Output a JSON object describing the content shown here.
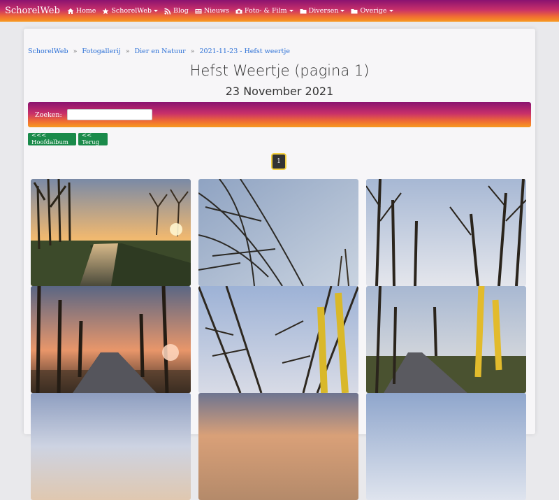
{
  "navbar": {
    "brand": "SchorelWeb",
    "items": [
      {
        "label": "Home",
        "icon": "home-icon",
        "dropdown": false
      },
      {
        "label": "SchorelWeb",
        "icon": "star-icon",
        "dropdown": true
      },
      {
        "label": "Blog",
        "icon": "rss-icon",
        "dropdown": false
      },
      {
        "label": "Nieuws",
        "icon": "newspaper-icon",
        "dropdown": false
      },
      {
        "label": "Foto- & Film",
        "icon": "camera-icon",
        "dropdown": true
      },
      {
        "label": "Diversen",
        "icon": "folder-icon",
        "dropdown": true
      },
      {
        "label": "Overige",
        "icon": "folder-icon",
        "dropdown": true
      }
    ]
  },
  "breadcrumb": [
    "SchorelWeb",
    "Fotogallerij",
    "Dier en Natuur",
    "2021-11-23 - Hefst weertje"
  ],
  "breadcrumb_separator": "»",
  "page": {
    "title": "Hefst Weertje (pagina 1)",
    "date": "23 November 2021"
  },
  "search": {
    "label": "Zoeken:",
    "value": ""
  },
  "buttons": {
    "main_album": "<<< Hoofdalbum",
    "back": "<< Terug"
  },
  "pagination": {
    "current": "1"
  },
  "colors": {
    "nav_start": "#8a1370",
    "nav_end": "#f79a1f",
    "button_green": "#1a8a4a",
    "link_blue": "#2a6fd6"
  }
}
